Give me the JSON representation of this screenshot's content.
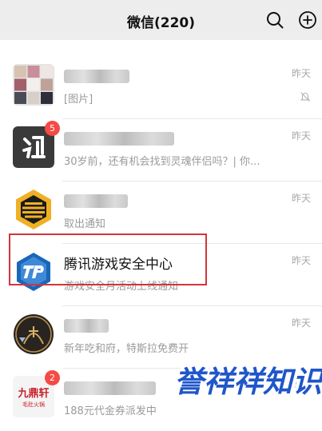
{
  "header": {
    "title": "微信(220)",
    "search_icon": "search-icon",
    "add_icon": "plus-circle-icon"
  },
  "chats": [
    {
      "name": "",
      "preview": "[图片]",
      "time": "昨天",
      "muted": true,
      "badge": "",
      "avatar_icon": "group-photo-grid-avatar"
    },
    {
      "name": "",
      "preview": "30岁前，还有机会找到灵魂伴侣吗？| 你...",
      "time": "昨天",
      "muted": false,
      "badge": "5",
      "avatar_icon": "app-logo-avatar"
    },
    {
      "name": "",
      "preview": "取出通知",
      "time": "昨天",
      "muted": false,
      "badge": "",
      "avatar_icon": "hexagon-logo-avatar"
    },
    {
      "name": "腾讯游戏安全中心",
      "preview": "游戏安全月活动上线通知",
      "time": "昨天",
      "muted": false,
      "badge": "",
      "avatar_icon": "tp-shield-logo-avatar"
    },
    {
      "name": "",
      "preview": "新年吃和府，特斯拉免费开",
      "time": "昨天",
      "muted": false,
      "badge": "",
      "avatar_icon": "restaurant-logo-avatar"
    },
    {
      "name": "",
      "preview": "188元代金券派发中",
      "time": "昨天",
      "muted": false,
      "badge": "2",
      "avatar_icon": "jiudingxuan-logo-avatar"
    }
  ],
  "avatar_text": {
    "jiudingxuan": "九鼎轩",
    "jiudingxuan_sub": "毛肚火锅"
  },
  "watermark": {
    "text": "誉祥祥知识",
    "colors": {
      "primary": "#1f56c9",
      "secondary": "#ffffff"
    }
  },
  "colors": {
    "header_bg": "#ededed",
    "badge_red": "#f54a45",
    "highlight_red": "#d3343c"
  }
}
